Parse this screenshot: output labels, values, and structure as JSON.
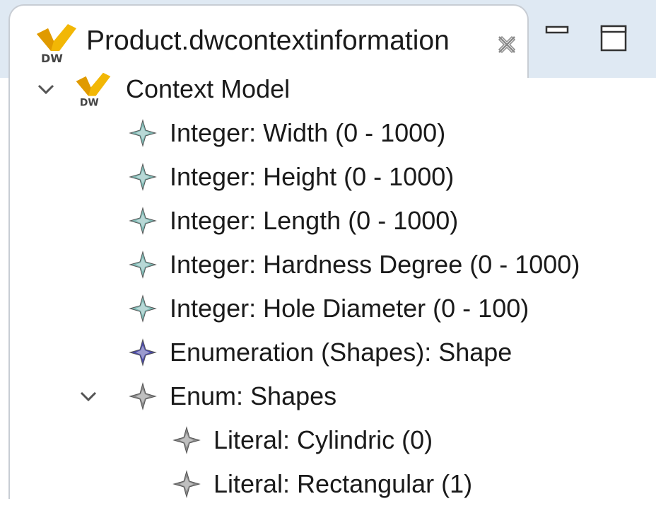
{
  "tab": {
    "title": "Product.dwcontextinformation",
    "icon": "dw-context-model-icon",
    "close_icon": "close-icon"
  },
  "window_controls": {
    "minimize_icon": "minimize-icon",
    "maximize_icon": "maximize-icon"
  },
  "tree": {
    "root": {
      "label": "Context Model",
      "icon": "dw-context-model-icon",
      "expanded": true
    },
    "attributes": [
      {
        "label": "Integer: Width (0 - 1000)",
        "icon": "attribute-integer-icon",
        "color": "#7fb9b4"
      },
      {
        "label": "Integer: Height (0 - 1000)",
        "icon": "attribute-integer-icon",
        "color": "#7fb9b4"
      },
      {
        "label": "Integer: Length (0 - 1000)",
        "icon": "attribute-integer-icon",
        "color": "#7fb9b4"
      },
      {
        "label": "Integer: Hardness Degree (0 - 1000)",
        "icon": "attribute-integer-icon",
        "color": "#7fb9b4"
      },
      {
        "label": "Integer: Hole Diameter (0 - 100)",
        "icon": "attribute-integer-icon",
        "color": "#7fb9b4"
      },
      {
        "label": "Enumeration (Shapes): Shape",
        "icon": "attribute-enumeration-icon",
        "color": "#4a4aa6"
      }
    ],
    "enum": {
      "label": "Enum: Shapes",
      "icon": "enum-icon",
      "expanded": true,
      "literals": [
        {
          "label": "Literal: Cylindric (0)",
          "icon": "enum-literal-icon"
        },
        {
          "label": "Literal: Rectangular (1)",
          "icon": "enum-literal-icon"
        }
      ]
    }
  },
  "colors": {
    "tab_strip": "#dfe9f3",
    "border": "#c8cdd4",
    "dw_logo_yellow": "#f2b705",
    "literal_gray": "#8a8a8a"
  }
}
